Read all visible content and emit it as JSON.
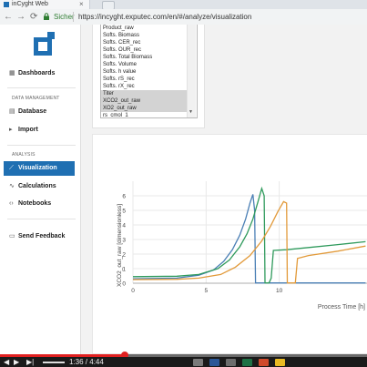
{
  "browser": {
    "tab_title": "inCyght Web",
    "secure_label": "Sicher",
    "url": "https://incyght.exputec.com/en/#/analyze/visualization",
    "back": "←",
    "forward": "→",
    "reload": "⟳"
  },
  "sidebar": {
    "dashboards": "Dashboards",
    "data_management_label": "DATA MANAGEMENT",
    "database": "Database",
    "import": "Import",
    "analysis_label": "ANALYSIS",
    "visualization": "Visualization",
    "calculations": "Calculations",
    "notebooks": "Notebooks",
    "send_feedback": "Send Feedback",
    "icons": {
      "dashboards": "dashboard-icon",
      "database": "database-icon",
      "import": "import-icon",
      "visualization": "chart-line-icon",
      "calculations": "calculator-icon",
      "notebooks": "code-icon",
      "send_feedback": "chat-icon"
    }
  },
  "variable_list": {
    "items": [
      {
        "label": "Product_raw",
        "selected": false
      },
      {
        "label": "Softs. Biomass",
        "selected": false
      },
      {
        "label": "Softs. CER_rec",
        "selected": false
      },
      {
        "label": "Softs. OUR_rec",
        "selected": false
      },
      {
        "label": "Softs. Total Biomass",
        "selected": false
      },
      {
        "label": "Softs. Volume",
        "selected": false
      },
      {
        "label": "Softs. h value",
        "selected": false
      },
      {
        "label": "Softs. rS_rec",
        "selected": false
      },
      {
        "label": "Softs. rX_rec",
        "selected": false
      },
      {
        "label": "Titer",
        "selected": true
      },
      {
        "label": "XCO2_out_raw",
        "selected": true
      },
      {
        "label": "XO2_out_raw",
        "selected": true
      },
      {
        "label": "rs_cmol_1",
        "selected": false
      }
    ]
  },
  "chart_data": {
    "type": "line",
    "ylabel": "XCO2_out_raw [dimensionless]",
    "xlabel": "Process Time [h]",
    "xlim": [
      0,
      16
    ],
    "ylim": [
      0,
      7
    ],
    "xticks": [
      0,
      5,
      10
    ],
    "yticks": [
      0,
      1,
      2,
      3,
      4,
      5,
      6
    ],
    "grid": true,
    "colors": {
      "blue": "#4a7fb5",
      "green": "#2f9a5c",
      "orange": "#e29a3a"
    },
    "series": [
      {
        "color": "blue",
        "points": [
          [
            0,
            0.3
          ],
          [
            3,
            0.35
          ],
          [
            4.5,
            0.55
          ],
          [
            5.5,
            0.9
          ],
          [
            6.2,
            1.5
          ],
          [
            6.8,
            2.3
          ],
          [
            7.3,
            3.3
          ],
          [
            7.7,
            4.4
          ],
          [
            8.0,
            5.5
          ],
          [
            8.2,
            6.1
          ],
          [
            8.32,
            5.0
          ],
          [
            8.38,
            0.02
          ],
          [
            15.9,
            0.02
          ]
        ]
      },
      {
        "color": "green",
        "points": [
          [
            0,
            0.45
          ],
          [
            3,
            0.48
          ],
          [
            4.5,
            0.6
          ],
          [
            5.8,
            1.0
          ],
          [
            6.6,
            1.6
          ],
          [
            7.3,
            2.5
          ],
          [
            7.8,
            3.4
          ],
          [
            8.2,
            4.4
          ],
          [
            8.55,
            5.6
          ],
          [
            8.8,
            6.5
          ],
          [
            8.97,
            6.0
          ],
          [
            9.03,
            0.02
          ],
          [
            9.3,
            0.02
          ],
          [
            9.45,
            0.35
          ],
          [
            9.6,
            2.25
          ],
          [
            10.5,
            2.3
          ],
          [
            12,
            2.45
          ],
          [
            14,
            2.65
          ],
          [
            15.9,
            2.85
          ]
        ]
      },
      {
        "color": "orange",
        "points": [
          [
            0,
            0.25
          ],
          [
            3,
            0.27
          ],
          [
            4.5,
            0.35
          ],
          [
            6,
            0.6
          ],
          [
            7,
            1.1
          ],
          [
            8,
            1.9
          ],
          [
            8.8,
            2.9
          ],
          [
            9.4,
            3.9
          ],
          [
            9.9,
            4.9
          ],
          [
            10.3,
            5.6
          ],
          [
            10.5,
            5.5
          ],
          [
            10.55,
            0.02
          ],
          [
            11.1,
            0.02
          ],
          [
            11.25,
            1.7
          ],
          [
            12,
            1.9
          ],
          [
            14,
            2.2
          ],
          [
            15.9,
            2.55
          ]
        ]
      }
    ]
  },
  "player": {
    "time": "1:36 / 4:44",
    "progress": 0.34,
    "colors": {
      "played": "#e02020",
      "bar": "#6a6a6a"
    }
  }
}
